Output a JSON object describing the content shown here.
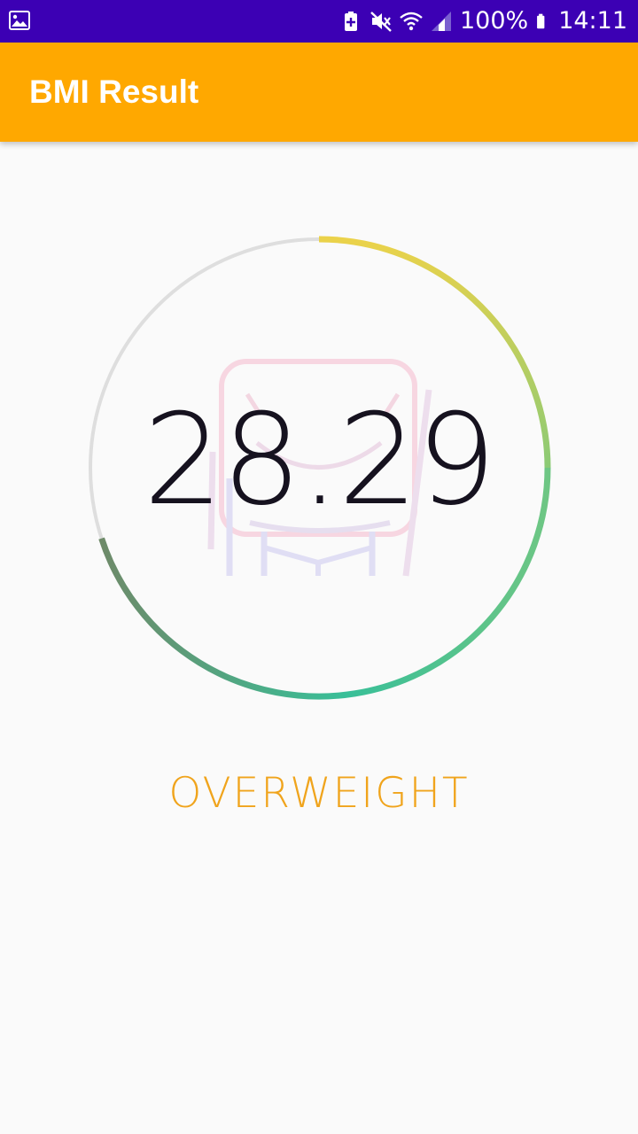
{
  "status_bar": {
    "battery_percent": "100%",
    "time": "14:11",
    "icons": [
      "image-icon",
      "battery-saver-icon",
      "mute-icon",
      "wifi-icon",
      "signal-icon",
      "battery-icon"
    ]
  },
  "app_bar": {
    "title": "BMI Result"
  },
  "result": {
    "bmi": "28.29",
    "category": "OVERWEIGHT",
    "gauge_progress": 0.7
  },
  "colors": {
    "status_bar": "#3c00b4",
    "app_bar": "#ffa800",
    "category_text": "#f0a41c",
    "gauge_track": "#dedede",
    "gauge_start": "#ebd24a",
    "gauge_mid": "#8bca75",
    "gauge_bottom": "#38bf98",
    "gauge_end": "#6e8a69"
  }
}
